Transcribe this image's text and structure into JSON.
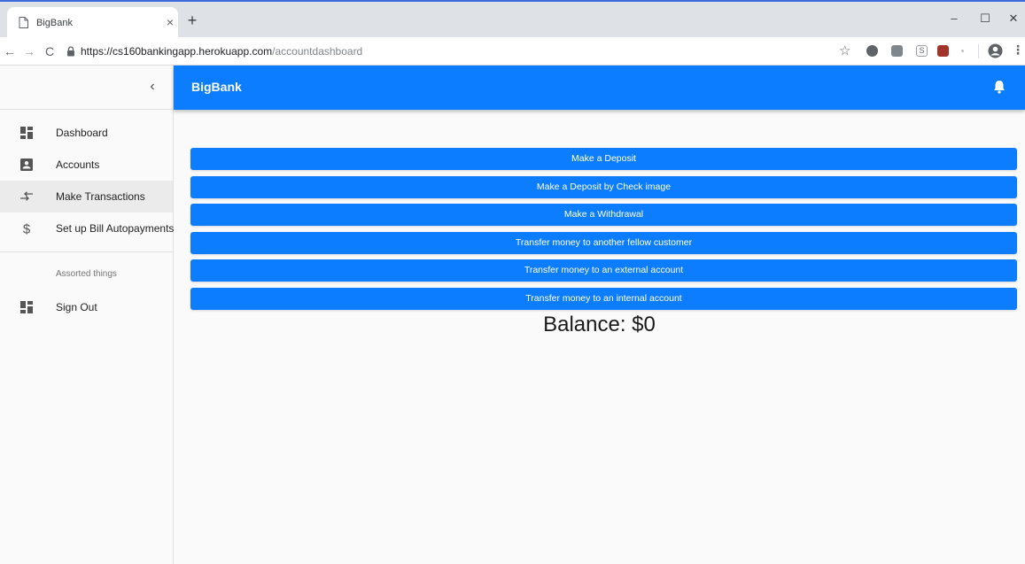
{
  "browser": {
    "tab_title": "BigBank",
    "tab_close": "×",
    "new_tab": "+",
    "window": {
      "minimize": "–",
      "maximize": "☐",
      "close": "✕"
    },
    "nav": {
      "back": "←",
      "forward": "→",
      "reload": "C"
    },
    "url_host": "https://cs160bankingapp.herokuapp.com",
    "url_path": "/accountdashboard",
    "bookmark_icon": "☆",
    "menu_icon": "⋮",
    "extension_s_label": "S"
  },
  "sidebar": {
    "collapse_icon": "‹",
    "items": [
      {
        "label": "Dashboard",
        "icon": "dashboard-icon"
      },
      {
        "label": "Accounts",
        "icon": "account-box-icon"
      },
      {
        "label": "Make Transactions",
        "icon": "swap-arrows-icon",
        "active": true
      },
      {
        "label": "Set up Bill Autopayments",
        "icon": "dollar-icon"
      }
    ],
    "section_header": "Assorted things",
    "secondary_items": [
      {
        "label": "Sign Out",
        "icon": "dashboard-icon"
      }
    ]
  },
  "appbar": {
    "title": "BigBank",
    "notification_icon": "bell-icon"
  },
  "actions": [
    {
      "label": "Make a Deposit"
    },
    {
      "label": "Make a Deposit by Check image"
    },
    {
      "label": "Make a Withdrawal"
    },
    {
      "label": "Transfer money to another fellow customer"
    },
    {
      "label": "Transfer money to an external account"
    },
    {
      "label": "Transfer money to an internal account"
    }
  ],
  "balance": {
    "text": "Balance: $0"
  },
  "colors": {
    "primary": "#0d7dff",
    "sidebar_active": "#ebebeb",
    "background": "#fafafa"
  }
}
